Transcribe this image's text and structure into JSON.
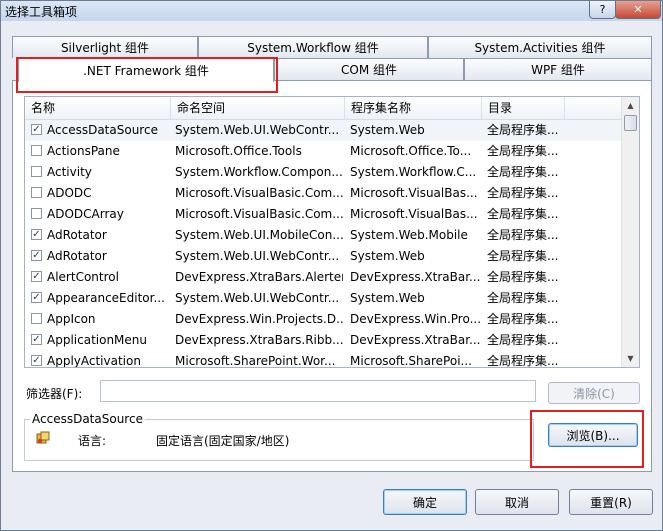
{
  "window": {
    "title": "选择工具箱项"
  },
  "titlebar": {
    "help": "?",
    "close": "✕"
  },
  "tabs_row1": [
    "Silverlight 组件",
    "System.Workflow 组件",
    "System.Activities 组件"
  ],
  "tabs_row2": [
    ".NET Framework 组件",
    "COM 组件",
    "WPF 组件"
  ],
  "table": {
    "columns": [
      "名称",
      "命名空间",
      "程序集名称",
      "目录"
    ],
    "rows": [
      {
        "checked": true,
        "name": "AccessDataSource",
        "ns": "System.Web.UI.WebContr...",
        "asm": "System.Web",
        "dir": "全局程序集..."
      },
      {
        "checked": false,
        "name": "ActionsPane",
        "ns": "Microsoft.Office.Tools",
        "asm": "Microsoft.Office.To...",
        "dir": "全局程序集..."
      },
      {
        "checked": false,
        "name": "Activity",
        "ns": "System.Workflow.Compon...",
        "asm": "System.Workflow.C...",
        "dir": "全局程序集..."
      },
      {
        "checked": false,
        "name": "ADODC",
        "ns": "Microsoft.VisualBasic.Com...",
        "asm": "Microsoft.VisualBas...",
        "dir": "全局程序集..."
      },
      {
        "checked": false,
        "name": "ADODCArray",
        "ns": "Microsoft.VisualBasic.Com...",
        "asm": "Microsoft.VisualBas...",
        "dir": "全局程序集..."
      },
      {
        "checked": true,
        "name": "AdRotator",
        "ns": "System.Web.UI.MobileCon...",
        "asm": "System.Web.Mobile",
        "dir": "全局程序集..."
      },
      {
        "checked": true,
        "name": "AdRotator",
        "ns": "System.Web.UI.WebContr...",
        "asm": "System.Web",
        "dir": "全局程序集..."
      },
      {
        "checked": true,
        "name": "AlertControl",
        "ns": "DevExpress.XtraBars.Alerter",
        "asm": "DevExpress.XtraBar...",
        "dir": "全局程序集..."
      },
      {
        "checked": true,
        "name": "AppearanceEditor...",
        "ns": "System.Web.UI.WebContr...",
        "asm": "System.Web",
        "dir": "全局程序集..."
      },
      {
        "checked": false,
        "name": "AppIcon",
        "ns": "DevExpress.Win.Projects.D...",
        "asm": "DevExpress.Win.Pro...",
        "dir": "全局程序集..."
      },
      {
        "checked": true,
        "name": "ApplicationMenu",
        "ns": "DevExpress.XtraBars.Ribb...",
        "asm": "DevExpress.XtraBar...",
        "dir": "全局程序集..."
      },
      {
        "checked": true,
        "name": "ApplyActivation",
        "ns": "Microsoft.SharePoint.Wor...",
        "asm": "Microsoft.SharePoi...",
        "dir": "全局程序集..."
      }
    ]
  },
  "filter": {
    "label": "筛选器(F):",
    "value": "",
    "clear_label": "清除(C)"
  },
  "details": {
    "title": "AccessDataSource",
    "language_label": "语言:",
    "language_value": "固定语言(固定国家/地区)",
    "browse_label": "浏览(B)..."
  },
  "footer": {
    "ok_label": "确定",
    "cancel_label": "取消",
    "reset_label": "重置(R)"
  },
  "colors": {
    "highlight": "#e02020",
    "checkmark": "#2d3f63"
  }
}
